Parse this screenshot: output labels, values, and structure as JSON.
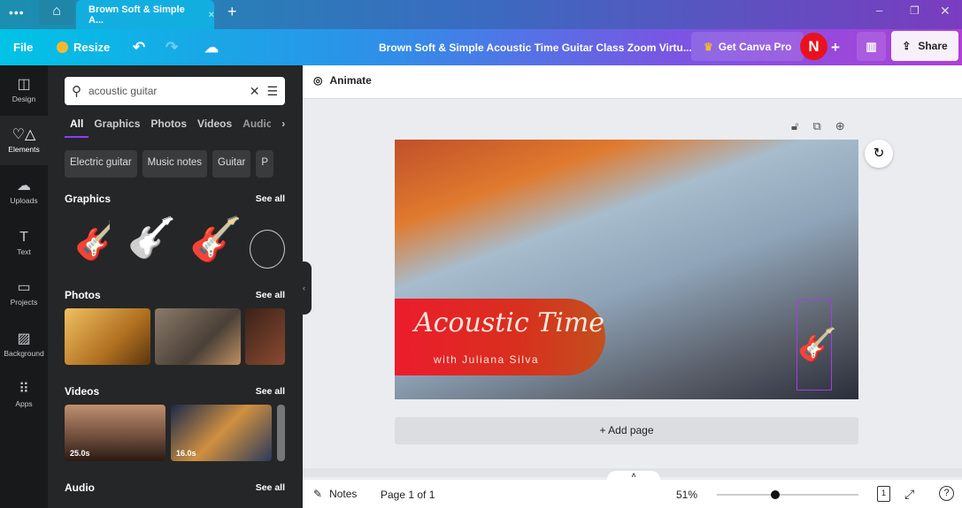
{
  "browser": {
    "tab_title": "Brown Soft & Simple A...",
    "new_tab": "+"
  },
  "toolbar": {
    "file": "File",
    "resize": "Resize",
    "doc_title": "Brown Soft & Simple Acoustic Time Guitar Class Zoom Virtu...",
    "get_pro": "Get Canva Pro",
    "avatar": "N",
    "share": "Share"
  },
  "rail": [
    {
      "label": "Design",
      "icon": "layout-icon"
    },
    {
      "label": "Elements",
      "icon": "shapes-icon"
    },
    {
      "label": "Uploads",
      "icon": "cloud-upload-icon"
    },
    {
      "label": "Text",
      "icon": "text-icon"
    },
    {
      "label": "Projects",
      "icon": "folder-icon"
    },
    {
      "label": "Background",
      "icon": "background-icon"
    },
    {
      "label": "Apps",
      "icon": "apps-icon"
    }
  ],
  "panel": {
    "search_value": "acoustic guitar",
    "tabs": [
      "All",
      "Graphics",
      "Photos",
      "Videos",
      "Audio"
    ],
    "active_tab": "All",
    "chips": [
      "Electric guitar",
      "Music notes",
      "Guitar",
      "P"
    ],
    "sections": {
      "graphics": "Graphics",
      "photos": "Photos",
      "videos": "Videos",
      "audio": "Audio"
    },
    "see_all": "See all",
    "video_durations": [
      "25.0s",
      "16.0s"
    ]
  },
  "canvas": {
    "animate": "Animate",
    "title_script": "Acoustic Time",
    "subtitle": "with Juliana Silva",
    "add_page": "+ Add page"
  },
  "bottom": {
    "notes": "Notes",
    "page": "Page 1 of 1",
    "zoom": "51%",
    "zoom_fraction": 0.51,
    "page_count": "1"
  },
  "colors": {
    "accent": "#8b3dff",
    "avatar": "#e8121f",
    "banner": "#e8202c"
  }
}
